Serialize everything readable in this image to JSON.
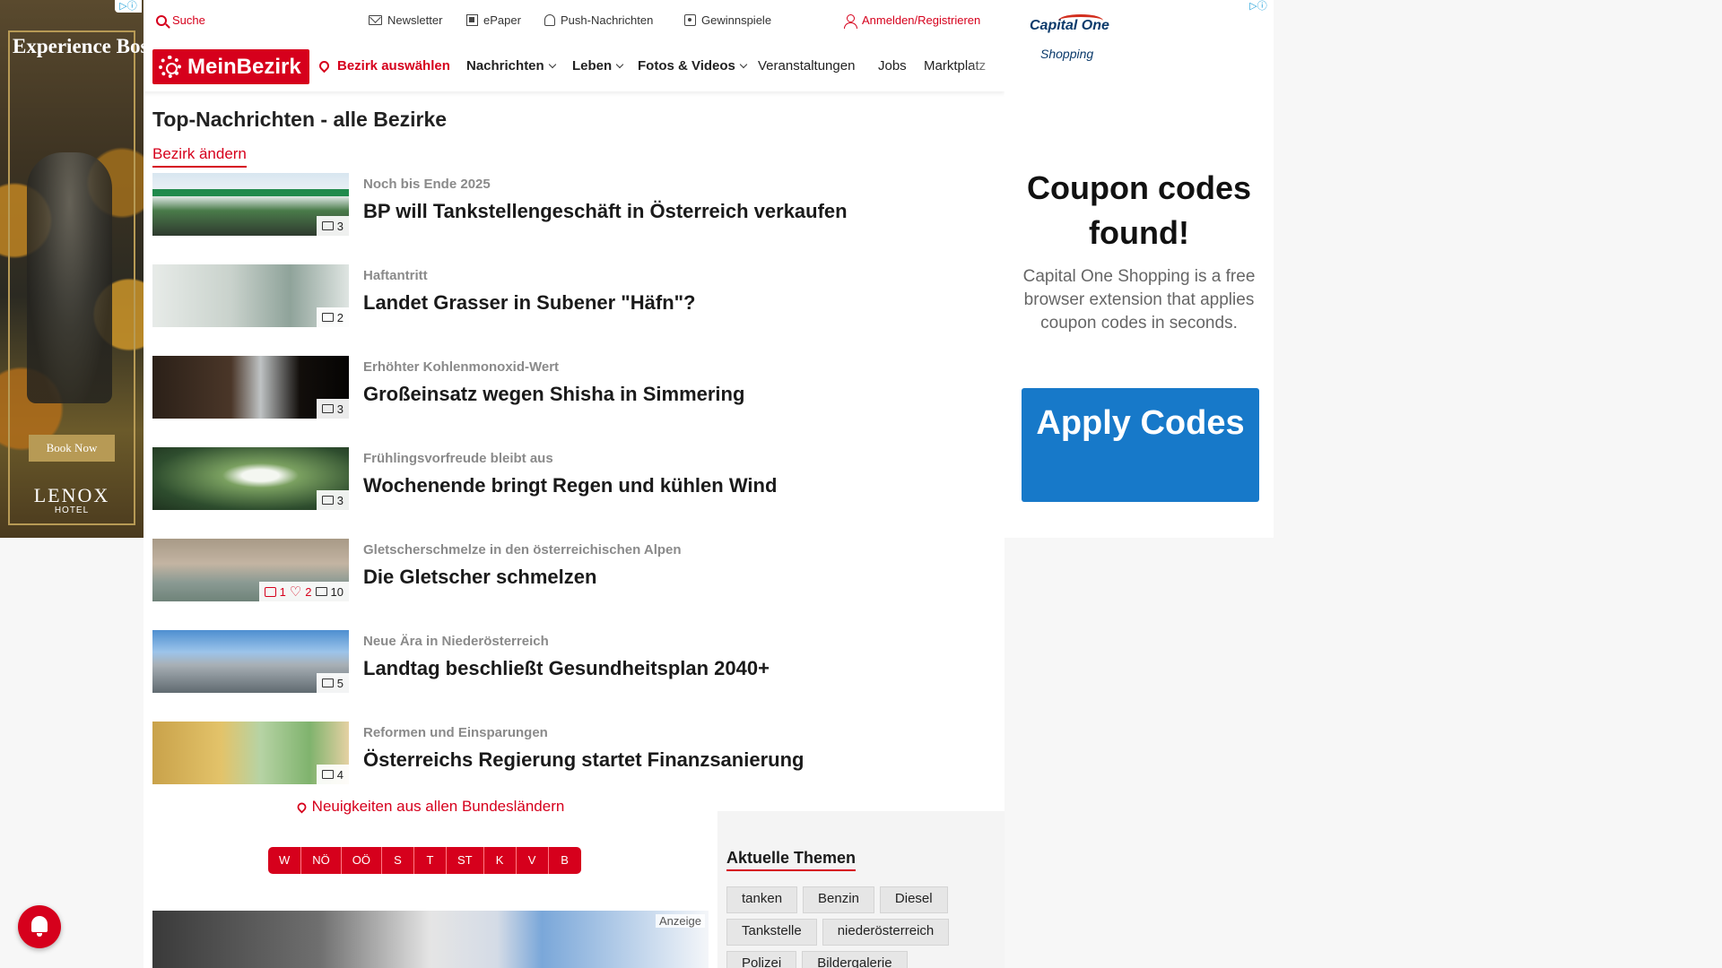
{
  "left_ad": {
    "headline": "Experience Boston's Back Bay",
    "button": "Book Now",
    "brand": "LENOX",
    "brand_sub": "HOTEL"
  },
  "topbar": {
    "search": "Suche",
    "newsletter": "Newsletter",
    "epaper": "ePaper",
    "push": "Push-Nachrichten",
    "games": "Gewinnspiele",
    "login": "Anmelden/Registrieren"
  },
  "nav": {
    "logo": "MeinBezirk",
    "bezirk": "Bezirk auswählen",
    "items": [
      "Nachrichten",
      "Leben",
      "Fotos & Videos",
      "Veranstaltungen",
      "Jobs",
      "Marktplatz"
    ]
  },
  "main": {
    "title": "Top-Nachrichten - alle Bezirke",
    "change_link": "Bezirk ändern",
    "articles": [
      {
        "kicker": "Noch bis Ende 2025",
        "headline": "BP will Tankstellengeschäft in Österreich verkaufen",
        "images": "3"
      },
      {
        "kicker": "Haftantritt",
        "headline": "Landet Grasser in Subener \"Häfn\"?",
        "images": "2"
      },
      {
        "kicker": "Erhöhter Kohlenmonoxid-Wert",
        "headline": "Großeinsatz wegen Shisha in Simmering",
        "images": "3"
      },
      {
        "kicker": "Frühlingsvorfreude bleibt aus",
        "headline": "Wochenende bringt Regen und kühlen Wind",
        "images": "3"
      },
      {
        "kicker": "Gletscherschmelze in den österreichischen Alpen",
        "headline": "Die Gletscher schmelzen",
        "images": "10",
        "comments": "1",
        "likes": "2"
      },
      {
        "kicker": "Neue Ära in Niederösterreich",
        "headline": "Landtag beschließt Gesundheitsplan 2040+",
        "images": "5"
      },
      {
        "kicker": "Reformen und Einsparungen",
        "headline": "Österreichs Regierung startet Finanzsanierung",
        "images": "4"
      }
    ]
  },
  "regions": {
    "link": "Neuigkeiten aus allen Bundesländern",
    "buttons": [
      "W",
      "NÖ",
      "OÖ",
      "S",
      "T",
      "ST",
      "K",
      "V",
      "B"
    ]
  },
  "ad_label": "Anzeige",
  "themes": {
    "title": "Aktuelle Themen",
    "tags": [
      "tanken",
      "Benzin",
      "Diesel",
      "Tankstelle",
      "niederösterreich",
      "Polizei",
      "Bildergalerie"
    ]
  },
  "right_ad": {
    "logo": "Capital One",
    "logo_sub": "Shopping",
    "title": "Coupon codes found!",
    "text": "Capital One Shopping is a free browser extension that applies coupon codes in seconds.",
    "button": "Apply Codes"
  },
  "colors": {
    "brand_red": "#d6001c",
    "ad_blue": "#1779c9"
  }
}
